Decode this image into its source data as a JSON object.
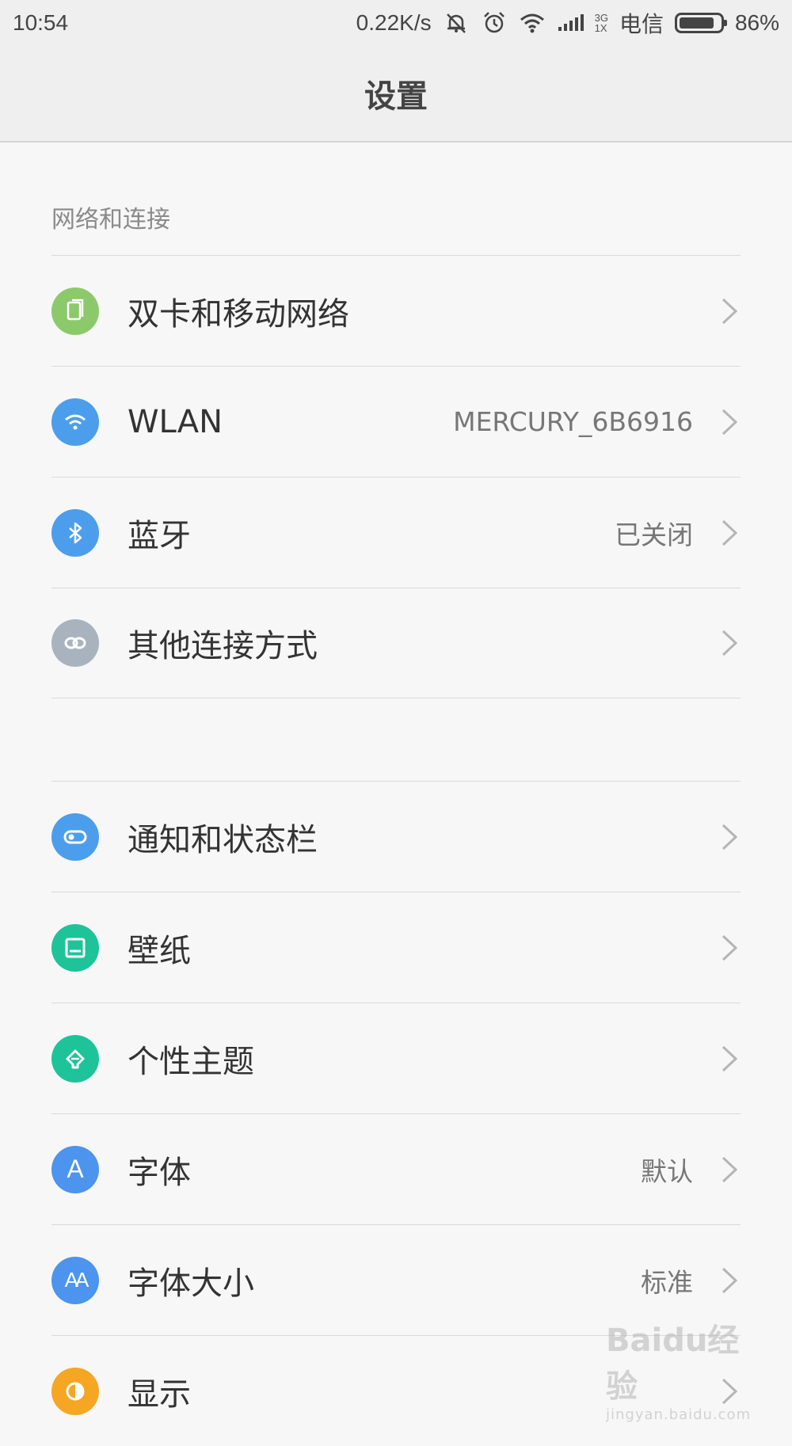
{
  "status_bar": {
    "time": "10:54",
    "speed": "0.22K/s",
    "net_type_top": "3G",
    "net_type_bottom": "1X",
    "carrier": "电信",
    "battery_percent": "86%",
    "battery_level": 0.86,
    "icons": [
      "mute-icon",
      "alarm-icon",
      "wifi-icon",
      "signal-icon"
    ]
  },
  "header": {
    "title": "设置"
  },
  "sections": [
    {
      "title": "网络和连接",
      "items": [
        {
          "label": "双卡和移动网络",
          "value": "",
          "icon": "sim-card-icon",
          "color": "#8cc96b"
        },
        {
          "label": "WLAN",
          "value": "MERCURY_6B6916",
          "icon": "wifi-icon",
          "color": "#4c9eec"
        },
        {
          "label": "蓝牙",
          "value": "已关闭",
          "icon": "bluetooth-icon",
          "color": "#4c9eec"
        },
        {
          "label": "其他连接方式",
          "value": "",
          "icon": "link-icon",
          "color": "#a8b3be"
        }
      ]
    },
    {
      "title": "",
      "items": [
        {
          "label": "通知和状态栏",
          "value": "",
          "icon": "toggle-icon",
          "color": "#4c9eec"
        },
        {
          "label": "壁纸",
          "value": "",
          "icon": "wallpaper-icon",
          "color": "#1ec39a"
        },
        {
          "label": "个性主题",
          "value": "",
          "icon": "theme-brush-icon",
          "color": "#1ec39a"
        },
        {
          "label": "字体",
          "value": "默认",
          "icon": "font-icon",
          "color": "#4c94ee"
        },
        {
          "label": "字体大小",
          "value": "标准",
          "icon": "font-size-icon",
          "color": "#4c94ee"
        },
        {
          "label": "显示",
          "value": "",
          "icon": "display-icon",
          "color": "#f5a623"
        }
      ]
    }
  ],
  "icon_glyphs": {
    "font_letter": "A",
    "font_size_letters": "AA"
  },
  "watermark": {
    "main": "Baidu经验",
    "sub": "jingyan.baidu.com"
  }
}
